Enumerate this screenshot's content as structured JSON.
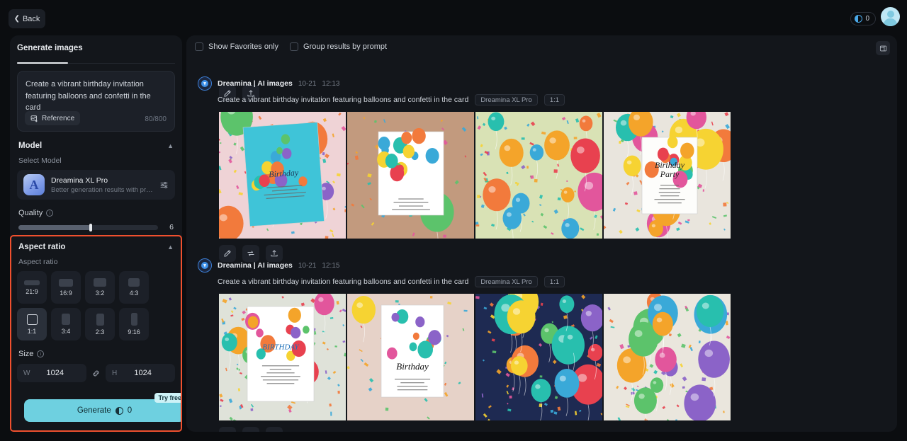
{
  "topbar": {
    "back_label": "Back",
    "back_icon": "chevron-left-icon",
    "credits": "0",
    "credit_icon": "coin-icon",
    "avatar_icon": "user-avatar"
  },
  "sidebar": {
    "tab_label": "Generate images",
    "prompt": {
      "value": "Create a vibrant birthday invitation featuring balloons and confetti in the card",
      "reference_label": "Reference",
      "reference_icon": "image-plus-icon",
      "counter": "80/800"
    },
    "model_section": {
      "title": "Model",
      "collapse_icon": "chevron-up-icon",
      "sub_label": "Select Model",
      "model_name": "Dreamina XL Pro",
      "model_desc": "Better generation results with profes...",
      "model_glyph": "A",
      "settings_icon": "sliders-icon"
    },
    "quality": {
      "label": "Quality",
      "info_icon": "info-icon",
      "value": "6",
      "fill_percent": 52
    },
    "aspect": {
      "title": "Aspect ratio",
      "collapse_icon": "chevron-up-icon",
      "sub_label": "Aspect ratio",
      "options": [
        {
          "label": "21:9",
          "w": 22,
          "h": 7,
          "selected": false
        },
        {
          "label": "16:9",
          "w": 20,
          "h": 11,
          "selected": false
        },
        {
          "label": "3:2",
          "w": 18,
          "h": 12,
          "selected": false
        },
        {
          "label": "4:3",
          "w": 16,
          "h": 12,
          "selected": false
        },
        {
          "label": "1:1",
          "w": 15,
          "h": 15,
          "selected": true
        },
        {
          "label": "3:4",
          "w": 12,
          "h": 16,
          "selected": false
        },
        {
          "label": "2:3",
          "w": 11,
          "h": 17,
          "selected": false
        },
        {
          "label": "9:16",
          "w": 9,
          "h": 18,
          "selected": false
        }
      ]
    },
    "size": {
      "label": "Size",
      "info_icon": "info-icon",
      "w_key": "W",
      "w_value": "1024",
      "h_key": "H",
      "h_value": "1024",
      "link_icon": "link-icon"
    },
    "generate": {
      "label": "Generate",
      "cost": "0",
      "coin_icon": "coin-icon",
      "badge": "Try free"
    },
    "highlight_color": "#f0502e"
  },
  "results_panel": {
    "filters": [
      {
        "label": "Show Favorites only",
        "checked": false
      },
      {
        "label": "Group results by prompt",
        "checked": false
      }
    ],
    "panel_toggle_icon": "panel-layout-icon",
    "ghost_actions": [
      "edit-icon",
      "download-icon"
    ],
    "results": [
      {
        "source": "Dreamina | AI images",
        "date": "10-21",
        "time": "12:13",
        "prompt": "Create a vibrant birthday invitation featuring balloons and confetti in the card",
        "model_tag": "Dreamina XL Pro",
        "ratio_tag": "1:1",
        "actions": [
          "edit-icon",
          "regenerate-icon",
          "download-icon"
        ],
        "images": [
          {
            "alt": "Teal birthday invitation card on pink background with balloons and confetti"
          },
          {
            "alt": "White folded birthday card with colorful balloons on tan backdrop"
          },
          {
            "alt": "Floating pastel balloons and confetti over green wall with podium"
          },
          {
            "alt": "Birthday Party invitation in gold frame surrounded by balloons"
          }
        ]
      },
      {
        "source": "Dreamina | AI images",
        "date": "10-21",
        "time": "12:15",
        "prompt": "Create a vibrant birthday invitation featuring balloons and confetti in the card",
        "model_tag": "Dreamina XL Pro",
        "ratio_tag": "1:1",
        "actions": [
          "edit-icon",
          "regenerate-icon",
          "download-icon"
        ],
        "images": [
          {
            "alt": "Happy Birthday flyer with pink ribbon on grey background and balloons"
          },
          {
            "alt": "White Birthday card with balloon bouquet on blush backdrop"
          },
          {
            "alt": "Navy Happy Birthday poster bordered by colorful balloons"
          },
          {
            "alt": "Flat lay white card with flat circle balloons and confetti"
          }
        ]
      }
    ]
  }
}
